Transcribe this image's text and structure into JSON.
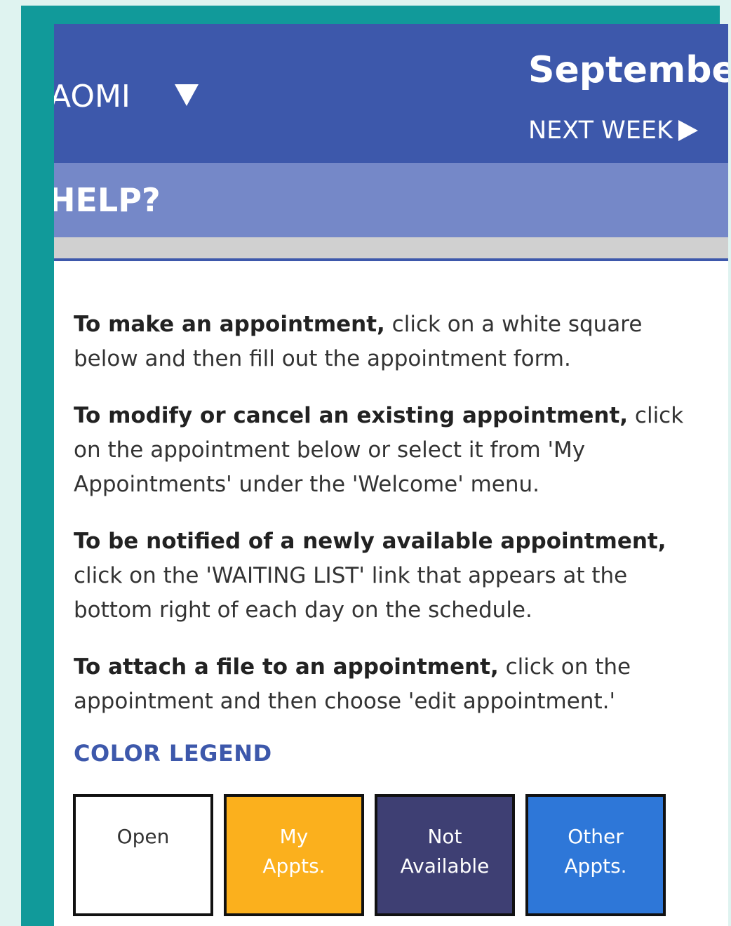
{
  "header": {
    "user_name": "AOMI",
    "month": "September",
    "next_week_label": "NEXT WEEK"
  },
  "help": {
    "title": "HELP?"
  },
  "instructions": [
    {
      "bold": "To make an appointment,",
      "text": " click on a white square below and then fill out the appointment form."
    },
    {
      "bold": "To modify or cancel an existing appointment,",
      "text": " click on the appointment below or select it from 'My Appointments' under the 'Welcome' menu."
    },
    {
      "bold": "To be notified of a newly available appointment,",
      "text": " click on the 'WAITING LIST' link that appears at the bottom right of each day on the schedule."
    },
    {
      "bold": "To attach a file to an appointment,",
      "text": " click on the appointment and then choose 'edit appointment.'"
    }
  ],
  "legend": {
    "title": "COLOR LEGEND",
    "items": [
      {
        "line1": "Open",
        "line2": "",
        "bg": "#ffffff",
        "fg": "#333333"
      },
      {
        "line1": "My",
        "line2": "Appts.",
        "bg": "#fbb01d",
        "fg": "#ffffff"
      },
      {
        "line1": "Not",
        "line2": "Available",
        "bg": "#3e3f73",
        "fg": "#ffffff"
      },
      {
        "line1": "Other",
        "line2": "Appts.",
        "bg": "#2e77d8",
        "fg": "#ffffff"
      }
    ]
  },
  "colors": {
    "frame": "#119a9a",
    "header": "#3d58ab",
    "help_bar": "#7588c8",
    "divider": "#d0d0d0"
  }
}
